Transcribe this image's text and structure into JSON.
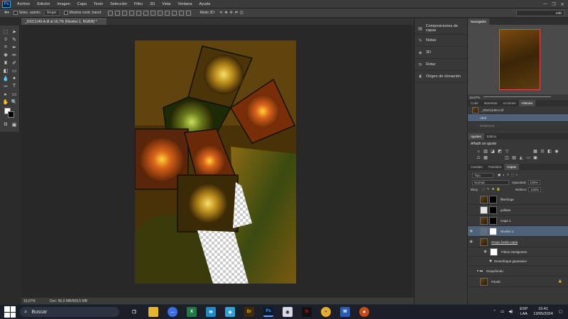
{
  "app": {
    "logo": "Ps"
  },
  "menu": [
    "Archivo",
    "Edición",
    "Imagen",
    "Capa",
    "Texto",
    "Selección",
    "Filtro",
    "3D",
    "Vista",
    "Ventana",
    "Ayuda"
  ],
  "options": {
    "auto_select_label": "Selec. autom.:",
    "auto_select_value": "Grupo",
    "show_transform_label": "Mostrar contr. transf.",
    "mode3d_label": "Modo 3D:",
    "search_value": "esb"
  },
  "document": {
    "tab_title": "_DSC1149-A.tif al 16,7% (Niveles 1, RGB/8) *",
    "zoom": "16,67%",
    "doc_size": "Doc: 96,0 MB/569,5 MB"
  },
  "mid_panels": [
    {
      "label": "Composiciones de capas",
      "icon": "layer-comps-icon"
    },
    {
      "label": "Notas",
      "icon": "notes-icon"
    },
    {
      "label": "3D",
      "icon": "3d-icon"
    },
    {
      "label": "Rotar",
      "icon": "rotate-icon"
    },
    {
      "label": "Origen de clonación",
      "icon": "clone-source-icon"
    }
  ],
  "navigator": {
    "tab": "Navegador",
    "zoom": "16,67%"
  },
  "history_tabs": [
    "Color",
    "Muestras",
    "Acciones",
    "Historia"
  ],
  "history": [
    {
      "label": "_DSC1149-A.tif",
      "selected": false
    },
    {
      "label": "Abrir",
      "selected": true
    },
    {
      "label": "Rasterizar",
      "selected": false
    }
  ],
  "adjust_tabs": [
    "Ajustes",
    "Estilos"
  ],
  "adjust_title": "Añadir un ajuste",
  "layers_tabs": [
    "Canales",
    "Trazados",
    "Capas"
  ],
  "layers_controls": {
    "filter": "Tipo",
    "blend": "Normal",
    "opacity_label": "Opacidad:",
    "opacity": "100%",
    "lock_label": "Bloq.:",
    "fill_label": "Relleno:",
    "fill": "100%"
  },
  "layers": [
    {
      "name": "filterforge",
      "visible": false,
      "selected": false,
      "mask": "black"
    },
    {
      "name": "pollans",
      "visible": false,
      "selected": false,
      "mask": "black"
    },
    {
      "name": "Capa 1",
      "visible": false,
      "selected": false,
      "mask": "black"
    },
    {
      "name": "Niveles 1",
      "visible": true,
      "selected": true,
      "mask": "white"
    },
    {
      "name": "Grupo fondo copia",
      "visible": true,
      "selected": false,
      "mask": "none"
    },
    {
      "name": "Filtros inteligentes",
      "visible": true,
      "selected": false,
      "mask": "white",
      "sub": true
    },
    {
      "name": "Desenfoque gaussiano",
      "visible": true,
      "selected": false,
      "mask": "none",
      "sub": true
    },
    {
      "name": "Grupofondo",
      "visible": false,
      "selected": false,
      "mask": "none"
    },
    {
      "name": "Fondo",
      "visible": false,
      "selected": false,
      "mask": "none"
    }
  ],
  "taskbar": {
    "search_placeholder": "Buscar",
    "lang": "ESP",
    "lang2": "LAA",
    "time": "15:41",
    "date": "13/05/2024"
  }
}
